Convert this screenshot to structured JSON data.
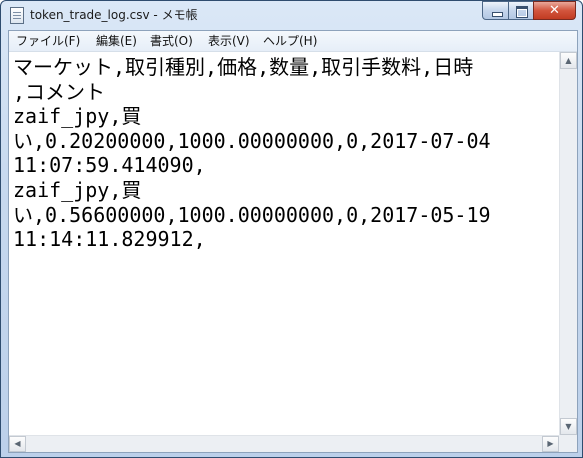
{
  "window": {
    "title": "token_trade_log.csv - メモ帳",
    "minimize_glyph": "",
    "maximize_glyph": "",
    "close_glyph": "✕"
  },
  "menu": {
    "items": [
      {
        "label": "ファイル(F)"
      },
      {
        "label": "編集(E)"
      },
      {
        "label": "書式(O)"
      },
      {
        "label": "表示(V)"
      },
      {
        "label": "ヘルプ(H)"
      }
    ]
  },
  "editor": {
    "lines": [
      "マーケット,取引種別,価格,数量,取引手数料,日時",
      ",コメント",
      "zaif_jpy,買",
      "い,0.20200000,1000.00000000,0,2017-07-04",
      "11:07:59.414090,",
      "zaif_jpy,買",
      "い,0.56600000,1000.00000000,0,2017-05-19",
      "11:14:11.829912,"
    ]
  },
  "scrollbars": {
    "up_arrow": "▲",
    "down_arrow": "▼",
    "left_arrow": "◀",
    "right_arrow": "▶"
  }
}
